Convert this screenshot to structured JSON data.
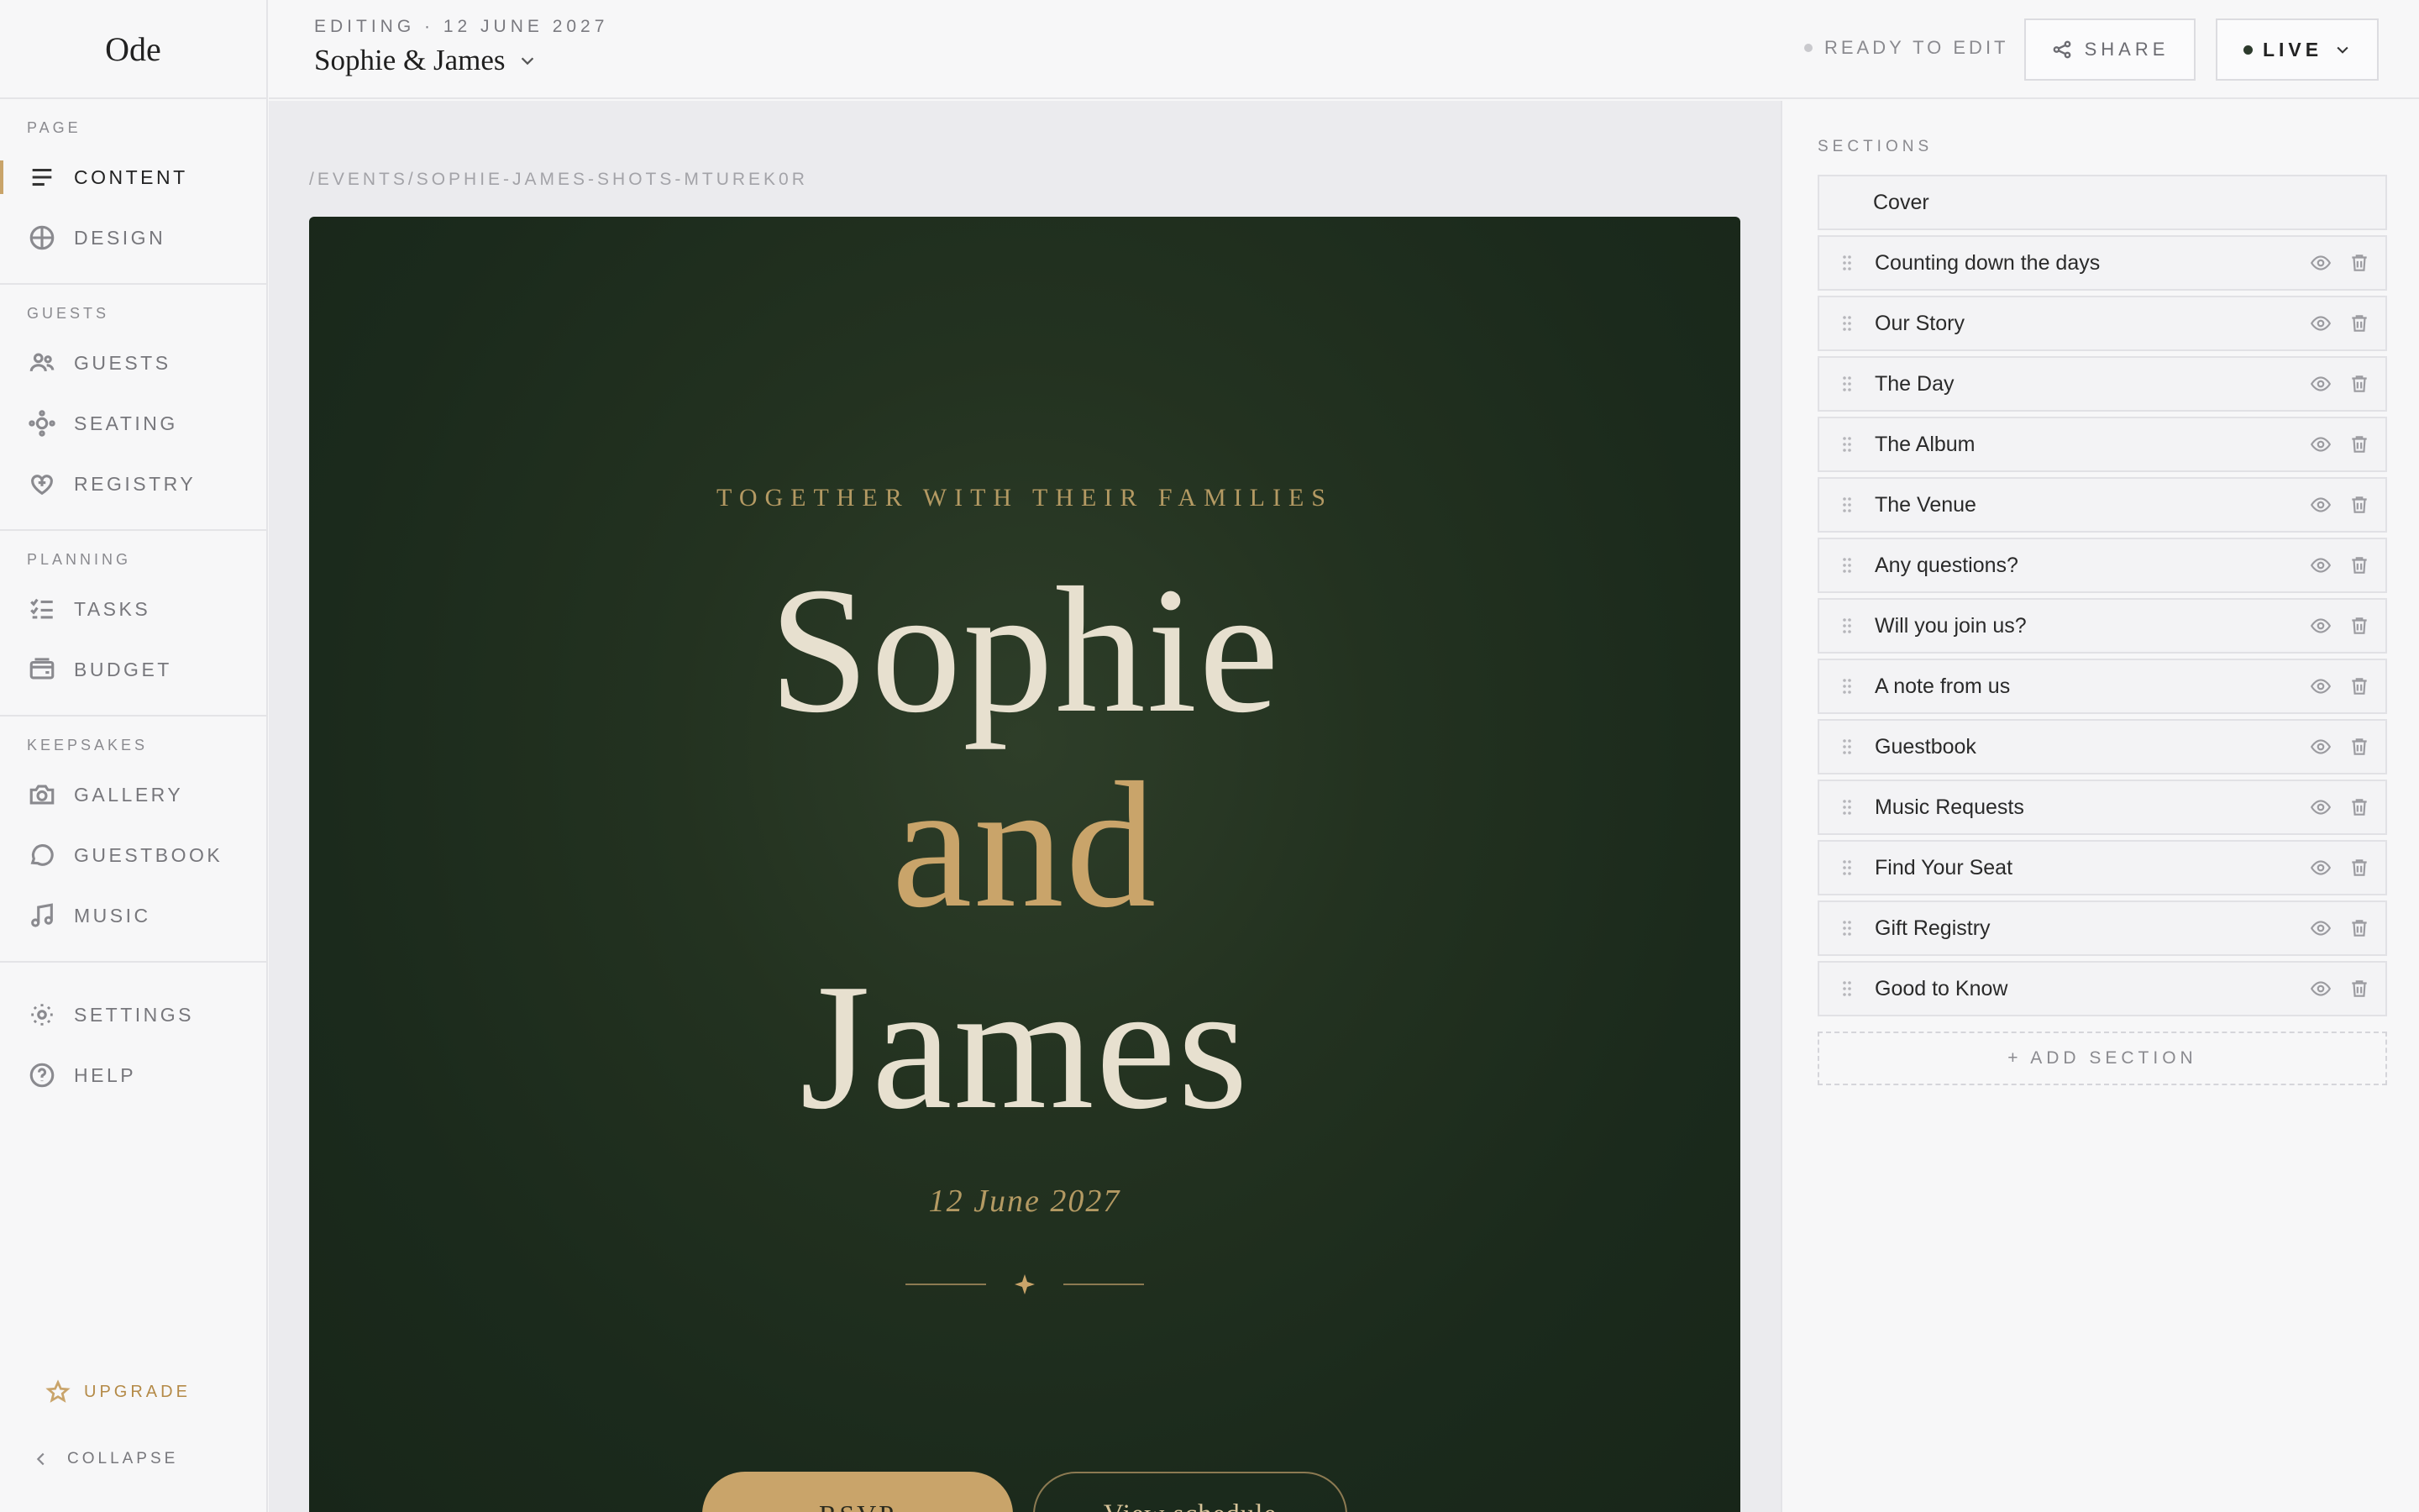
{
  "app": {
    "logo": "Ode"
  },
  "sidebar": {
    "groups": [
      {
        "label": "PAGE",
        "items": [
          {
            "label": "CONTENT",
            "icon": "lines-icon"
          },
          {
            "label": "DESIGN",
            "icon": "globe-icon"
          }
        ]
      },
      {
        "label": "GUESTS",
        "items": [
          {
            "label": "GUESTS",
            "icon": "people-icon"
          },
          {
            "label": "SEATING",
            "icon": "seating-icon"
          },
          {
            "label": "REGISTRY",
            "icon": "heart-gift-icon"
          }
        ]
      },
      {
        "label": "PLANNING",
        "items": [
          {
            "label": "TASKS",
            "icon": "checklist-icon"
          },
          {
            "label": "BUDGET",
            "icon": "wallet-icon"
          }
        ]
      },
      {
        "label": "KEEPSAKES",
        "items": [
          {
            "label": "GALLERY",
            "icon": "camera-icon"
          },
          {
            "label": "GUESTBOOK",
            "icon": "chat-bubble-icon"
          },
          {
            "label": "MUSIC",
            "icon": "music-note-icon"
          }
        ]
      }
    ],
    "bottom_items": [
      {
        "label": "SETTINGS",
        "icon": "sun-gear-icon"
      },
      {
        "label": "HELP",
        "icon": "question-circle-icon"
      }
    ],
    "upgrade": "UPGRADE",
    "collapse": "COLLAPSE",
    "active": "CONTENT"
  },
  "header": {
    "editing_label": "EDITING · 12 JUNE 2027",
    "event_title": "Sophie & James",
    "status": "READY TO EDIT",
    "share_label": "SHARE",
    "live_label": "LIVE"
  },
  "canvas": {
    "path": "/EVENTS/SOPHIE-JAMES-SHOTS-MTUREK0R",
    "hero": {
      "eyebrow": "TOGETHER WITH THEIR FAMILIES",
      "name1": "Sophie",
      "connector": "and",
      "name2": "James",
      "date": "12 June 2027",
      "rsvp": "RSVP",
      "schedule": "View schedule"
    }
  },
  "sections_panel": {
    "label": "SECTIONS",
    "items": [
      "Cover",
      "Counting down the days",
      "Our Story",
      "The Day",
      "The Album",
      "The Venue",
      "Any questions?",
      "Will you join us?",
      "A note from us",
      "Guestbook",
      "Music Requests",
      "Find Your Seat",
      "Gift Registry",
      "Good to Know"
    ],
    "add_label": "+ ADD SECTION"
  },
  "colors": {
    "accent_gold": "#c9a46a",
    "hero_green": "#1f2e1e",
    "ivory": "#e7e0cf"
  }
}
